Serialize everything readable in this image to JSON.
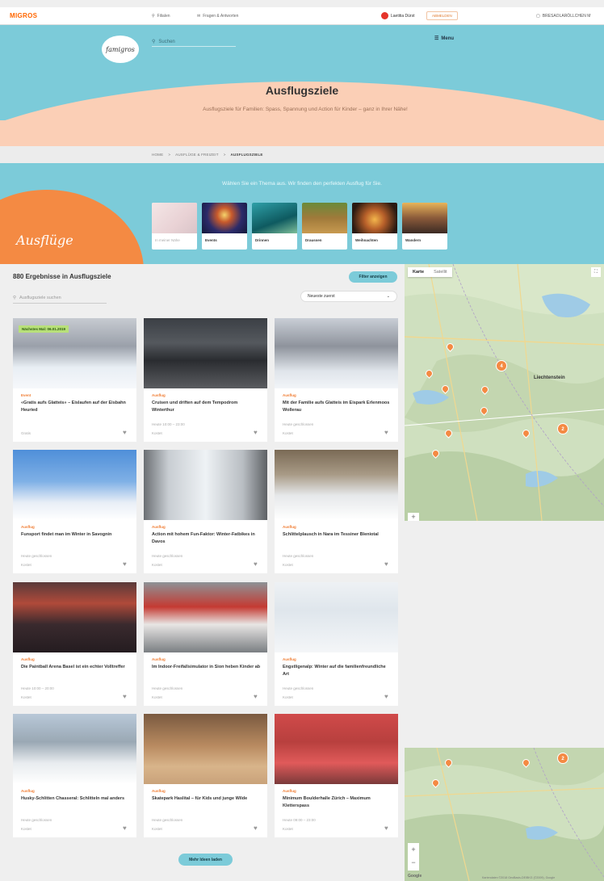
{
  "topbar": {
    "brand": "MIGROS",
    "links": [
      "Filialen",
      "Fragen & Antworten"
    ],
    "user_name": "Laetitia Dürst",
    "logout": "ABMELDEN",
    "cart": "BRESAOLARÖLLCHEN M"
  },
  "hero": {
    "logo": "famigros",
    "search_placeholder": "Suchen",
    "menu": "Menu",
    "title": "Ausflugsziele",
    "subtitle": "Ausflugsziele für Familien: Spass, Spannung und Action für Kinder – ganz in Ihrer Nähe!"
  },
  "breadcrumb": [
    "HOME",
    "AUSFLÜGE & FREIZEIT",
    "AUSFLUGSZIELE"
  ],
  "themes": {
    "lead": "Wählen Sie ein Thema aus. Wir finden den perfekten Ausflug für Sie.",
    "script_label": "Ausflüge",
    "tiles": [
      "In meiner Nähe",
      "Events",
      "Drinnen",
      "Draussen",
      "Weihnachten",
      "Wandern"
    ]
  },
  "results": {
    "count": "880 Ergebnisse in Ausflugsziele",
    "filter": "Filter anzeigen",
    "search_placeholder": "Ausflugsziele suchen",
    "sort": "Neueste zuerst",
    "load_more": "Mehr Ideen laden",
    "cards": [
      {
        "badge": "Nächstes Mal: 06.01.2019",
        "cat": "Event",
        "title": "«Gratis aufs Glatteis» – Eislaufen auf der Eisbahn Heuried",
        "open": "",
        "price": "Gratis"
      },
      {
        "badge": "",
        "cat": "Ausflug",
        "title": "Cruisen und driften auf dem Tempodrom Winterthur",
        "open": "Heute 10:00 – 23:00",
        "price": "Kostet"
      },
      {
        "badge": "",
        "cat": "Ausflug",
        "title": "Mit der Familie aufs Glatteis im Eispark Erlenmoos Wollerau",
        "open": "Heute geschlossen",
        "price": "Kostet"
      },
      {
        "badge": "",
        "cat": "Ausflug",
        "title": "Funsport findet man im Winter in Savognin",
        "open": "Heute geschlossen",
        "price": "Kostet"
      },
      {
        "badge": "",
        "cat": "Ausflug",
        "title": "Action mit hohem Fun-Faktor: Winter-Fatbikes in Davos",
        "open": "Heute geschlossen",
        "price": "Kostet"
      },
      {
        "badge": "",
        "cat": "Ausflug",
        "title": "Schlittelplausch in Nara im Tessiner Bleniotal",
        "open": "Heute geschlossen",
        "price": "Kostet"
      },
      {
        "badge": "",
        "cat": "Ausflug",
        "title": "Die Paintball Arena Basel ist ein echter Volltreffer",
        "open": "Heute 10:00 – 20:00",
        "price": "Kostet"
      },
      {
        "badge": "",
        "cat": "Ausflug",
        "title": "Im Indoor-Freifallsimulator in Sion heben Kinder ab",
        "open": "Heute geschlossen",
        "price": "Kostet"
      },
      {
        "badge": "",
        "cat": "Ausflug",
        "title": "Engstligenalp: Winter auf die familienfreundliche Art",
        "open": "Heute geschlossen",
        "price": "Kostet"
      },
      {
        "badge": "",
        "cat": "Ausflug",
        "title": "Husky-Schlitten Chasseral: Schlitteln mal anders",
        "open": "Heute geschlossen",
        "price": "Kostet"
      },
      {
        "badge": "",
        "cat": "Ausflug",
        "title": "Skatepark Haslital – für Kids und junge Wilde",
        "open": "Heute geschlossen",
        "price": "Kostet"
      },
      {
        "badge": "",
        "cat": "Ausflug",
        "title": "Minimum Boulderhalle Zürich – Maximum Kletterspass",
        "open": "Heute 09:00 – 23:00",
        "price": "Kostet"
      }
    ]
  },
  "map": {
    "tab_map": "Karte",
    "tab_sat": "Satellit",
    "label": "Liechtenstein",
    "clusters": [
      "4",
      "2",
      "2"
    ],
    "google": "Google",
    "credit": "Kartendaten ©2018 GeoBasis-DE/BKG (©2009), Google"
  },
  "colors": {
    "teal": "#7ccbd9",
    "peach": "#fbcfb6",
    "orange": "#f48a43",
    "migros": "#ff6600"
  }
}
